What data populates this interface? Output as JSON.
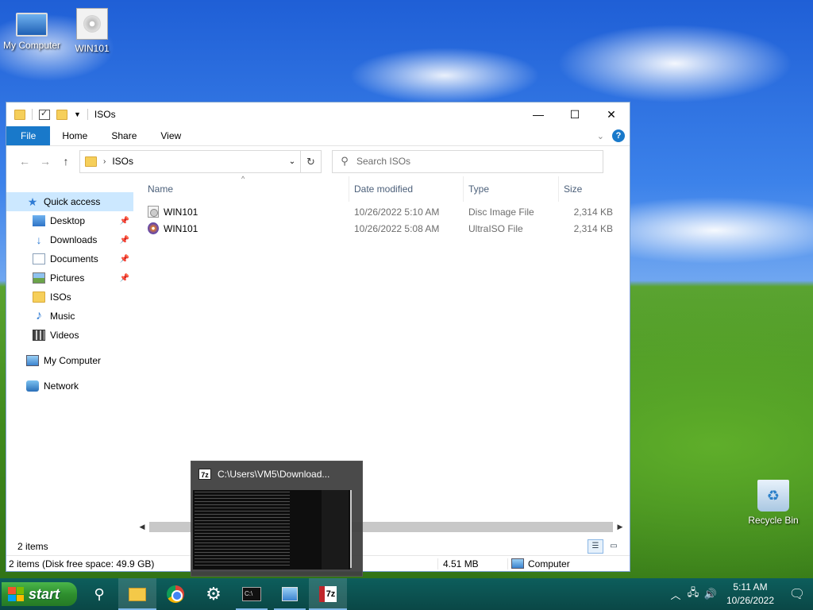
{
  "desktop": {
    "icons": [
      {
        "label": "My Computer",
        "icon": "computer-icon"
      },
      {
        "label": "WIN101",
        "icon": "disc-image-icon"
      },
      {
        "label": "Recycle Bin",
        "icon": "recycle-bin-icon"
      }
    ]
  },
  "window": {
    "title": "ISOs",
    "ribbon_tabs": [
      "File",
      "Home",
      "Share",
      "View"
    ],
    "address": {
      "path": "ISOs",
      "separator": "›"
    },
    "search_placeholder": "Search ISOs",
    "nav_pane": {
      "quick_access": "Quick access",
      "items": [
        {
          "label": "Desktop",
          "icon": "desktop-icon",
          "pinned": true
        },
        {
          "label": "Downloads",
          "icon": "downloads-icon",
          "pinned": true
        },
        {
          "label": "Documents",
          "icon": "documents-icon",
          "pinned": true
        },
        {
          "label": "Pictures",
          "icon": "pictures-icon",
          "pinned": true
        },
        {
          "label": "ISOs",
          "icon": "folder-icon",
          "pinned": false
        },
        {
          "label": "Music",
          "icon": "music-icon",
          "pinned": false
        },
        {
          "label": "Videos",
          "icon": "videos-icon",
          "pinned": false
        }
      ],
      "my_computer": "My Computer",
      "network": "Network"
    },
    "columns": {
      "name": "Name",
      "date": "Date modified",
      "type": "Type",
      "size": "Size"
    },
    "files": [
      {
        "name": "WIN101",
        "date": "10/26/2022 5:10 AM",
        "type": "Disc Image File",
        "size": "2,314 KB",
        "icon": "disc-image-file-icon"
      },
      {
        "name": "WIN101",
        "date": "10/26/2022 5:08 AM",
        "type": "UltraISO File",
        "size": "2,314 KB",
        "icon": "ultraiso-file-icon"
      }
    ],
    "item_count": "2 items",
    "status": {
      "disk": "2 items (Disk free space: 49.9 GB)",
      "size": "4.51 MB",
      "location": "Computer"
    }
  },
  "thumbnail": {
    "title": "C:\\Users\\VM5\\Download...",
    "icon_text": "7z"
  },
  "taskbar": {
    "start_label": "start",
    "time": "5:11 AM",
    "date": "10/26/2022"
  },
  "colors": {
    "accent": "#1979ca",
    "selection": "#cce8ff",
    "taskbar": "#0d5e5c",
    "start_green": "#2e8f2e"
  }
}
